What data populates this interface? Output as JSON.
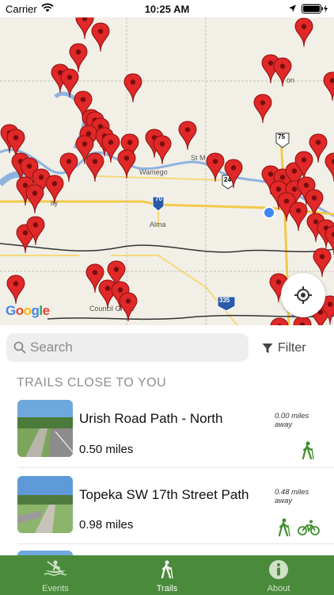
{
  "status_bar": {
    "carrier": "Carrier",
    "time": "10:25 AM"
  },
  "map": {
    "town_labels": [
      "Wamego",
      "St M",
      "Alma",
      "Council Grove",
      "on",
      "ity"
    ],
    "highway_shields": [
      "70",
      "75",
      "335",
      "24"
    ],
    "google_logo": [
      "G",
      "o",
      "o",
      "g",
      "l",
      "e"
    ],
    "pin_color": "#e02828",
    "locate_icon": "crosshair-icon"
  },
  "search": {
    "placeholder": "Search",
    "value": ""
  },
  "filter": {
    "label": "Filter"
  },
  "section_header": "TRAILS CLOSE TO YOU",
  "trails": [
    {
      "name": "Urish Road Path - North",
      "distance": "0.50 miles",
      "away": "0.00 miles away",
      "activities": [
        "hiking-icon"
      ]
    },
    {
      "name": "Topeka SW 17th Street Path",
      "distance": "0.98 miles",
      "away": "0.48 miles away",
      "activities": [
        "hiking-icon",
        "biking-icon"
      ]
    }
  ],
  "tabs": [
    {
      "label": "Events",
      "icon": "kayak-icon"
    },
    {
      "label": "Trails",
      "icon": "hiking-icon"
    },
    {
      "label": "About",
      "icon": "info-icon"
    }
  ],
  "colors": {
    "accent": "#4a8b3b",
    "activity_icon": "#3f8f2e",
    "pin": "#e02828"
  }
}
